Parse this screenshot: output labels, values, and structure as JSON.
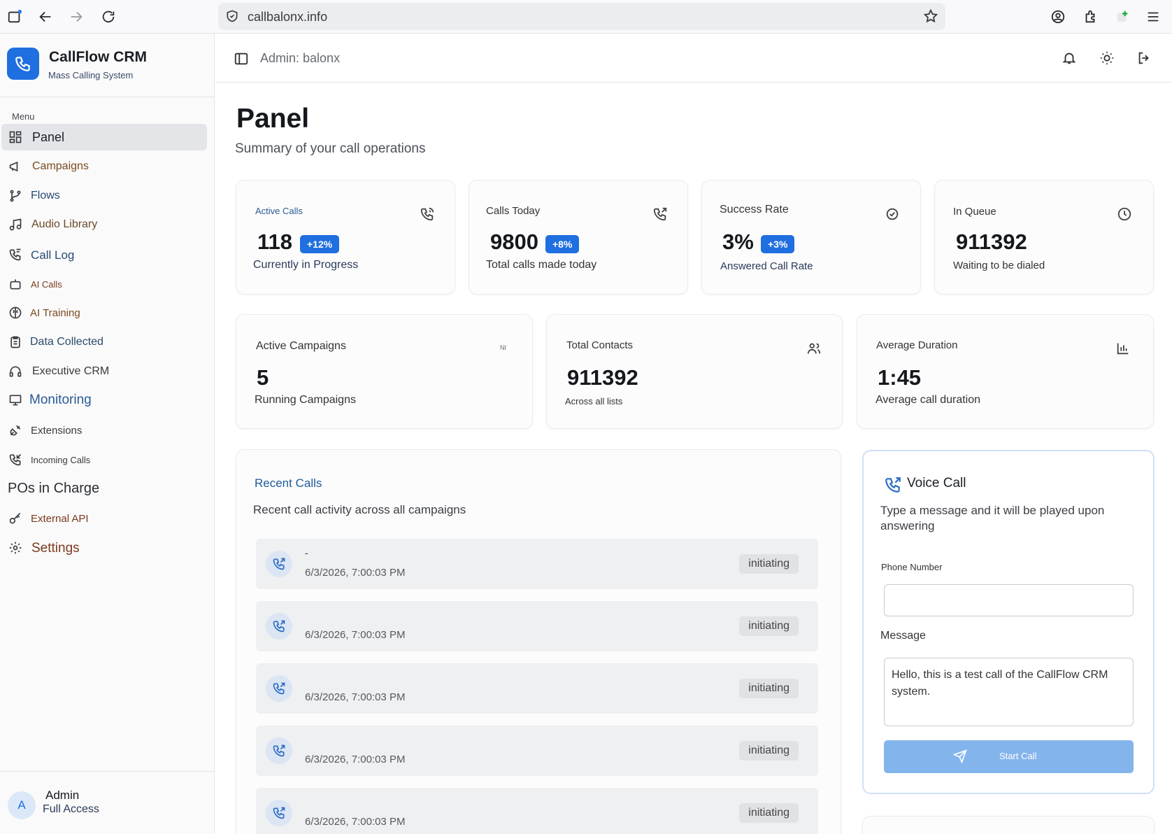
{
  "browser": {
    "url": "callbalonx.info"
  },
  "brand": {
    "name": "CallFlow CRM",
    "subtitle": "Mass Calling System"
  },
  "sidebar": {
    "menu_label": "Menu",
    "items": [
      {
        "label": "Panel",
        "icon": "grid-icon"
      },
      {
        "label": "Campaigns",
        "icon": "megaphone-icon"
      },
      {
        "label": "Flows",
        "icon": "git-branch-icon"
      },
      {
        "label": "Audio Library",
        "icon": "music-icon"
      },
      {
        "label": "Call Log",
        "icon": "phone-log-icon"
      },
      {
        "label": "AI Calls",
        "icon": "bot-icon"
      },
      {
        "label": "AI Training",
        "icon": "brain-icon"
      },
      {
        "label": "Data Collected",
        "icon": "clipboard-icon"
      },
      {
        "label": "Executive CRM",
        "icon": "headset-icon"
      },
      {
        "label": "Monitoring",
        "icon": "monitor-icon"
      },
      {
        "label": "Extensions",
        "icon": "plug-icon"
      },
      {
        "label": "Incoming Calls",
        "icon": "phone-incoming-icon"
      },
      {
        "label": "POs in Charge",
        "icon": ""
      },
      {
        "label": "External API",
        "icon": "key-icon"
      },
      {
        "label": "Settings",
        "icon": "gear-icon"
      }
    ],
    "user": {
      "initial": "A",
      "name": "Admin",
      "role": "Full Access"
    }
  },
  "header": {
    "admin_label": "Admin: balonx"
  },
  "main": {
    "title": "Panel",
    "subtitle": "Summary of your call operations",
    "stats": [
      {
        "title": "Active Calls",
        "value": "118",
        "badge": "+12%",
        "desc": "Currently in Progress"
      },
      {
        "title": "Calls Today",
        "value": "9800",
        "badge": "+8%",
        "desc": "Total calls made today"
      },
      {
        "title": "Success Rate",
        "value": "3%",
        "badge": "+3%",
        "desc": "Answered Call Rate"
      },
      {
        "title": "In Queue",
        "value": "911392",
        "desc": "Waiting to be dialed"
      }
    ],
    "stats2": [
      {
        "title": "Active Campaigns",
        "icon_text": "NI",
        "value": "5",
        "desc": "Running Campaigns"
      },
      {
        "title": "Total Contacts",
        "value": "911392",
        "desc": "Across all lists"
      },
      {
        "title": "Average Duration",
        "value": "1:45",
        "desc": "Average call duration"
      }
    ],
    "recent_calls": {
      "title": "Recent Calls",
      "subtitle": "Recent call activity across all campaigns",
      "rows": [
        {
          "name": "-",
          "time": "6/3/2026, 7:00:03 PM",
          "status": "initiating"
        },
        {
          "name": "",
          "time": "6/3/2026, 7:00:03 PM",
          "status": "initiating"
        },
        {
          "name": "",
          "time": "6/3/2026, 7:00:03 PM",
          "status": "initiating"
        },
        {
          "name": "",
          "time": "6/3/2026, 7:00:03 PM",
          "status": "initiating"
        },
        {
          "name": "",
          "time": "6/3/2026, 7:00:03 PM",
          "status": "initiating"
        }
      ]
    },
    "voice_call": {
      "title": "Voice Call",
      "description": "Type a message and it will be played upon answering",
      "phone_label": "Phone Number",
      "phone_value": "",
      "message_label": "Message",
      "message_value": "Hello, this is a test call of the CallFlow CRM system.",
      "button_label": "Start Call"
    }
  }
}
